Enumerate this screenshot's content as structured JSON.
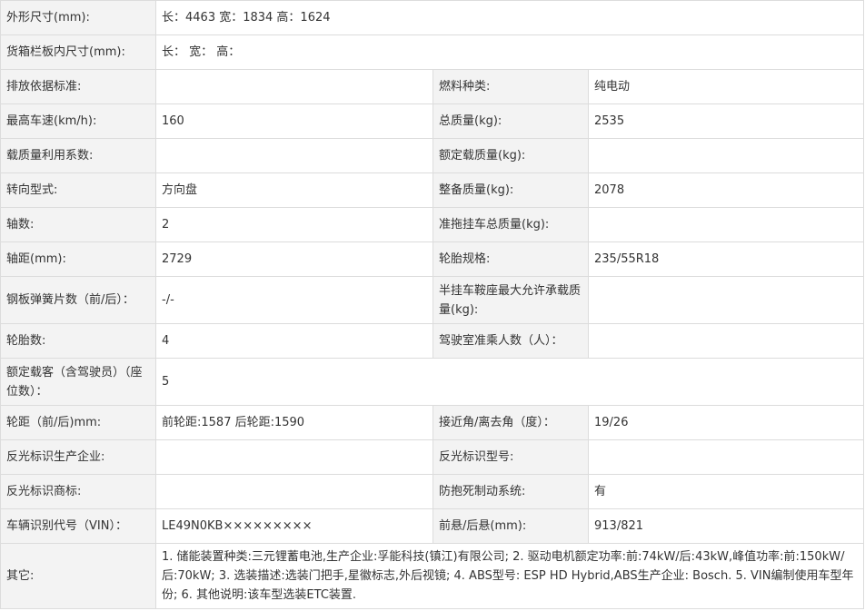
{
  "rows": [
    {
      "l1": "外形尺寸(mm):",
      "v1": "长：4463 宽：1834 高：1624"
    },
    {
      "l1": "货箱栏板内尺寸(mm):",
      "v1": "长：  宽：  高："
    },
    {
      "l1": "排放依据标准:",
      "v1": "",
      "l2": "燃料种类:",
      "v2": "纯电动"
    },
    {
      "l1": "最高车速(km/h):",
      "v1": "160",
      "l2": "总质量(kg):",
      "v2": "2535"
    },
    {
      "l1": "载质量利用系数:",
      "v1": "",
      "l2": "额定载质量(kg):",
      "v2": ""
    },
    {
      "l1": "转向型式:",
      "v1": "方向盘",
      "l2": "整备质量(kg):",
      "v2": "2078"
    },
    {
      "l1": "轴数:",
      "v1": "2",
      "l2": "准拖挂车总质量(kg):",
      "v2": ""
    },
    {
      "l1": "轴距(mm):",
      "v1": "2729",
      "l2": "轮胎规格:",
      "v2": "235/55R18"
    },
    {
      "l1": "钢板弹簧片数（前/后）：",
      "v1": "-/-",
      "l2": "半挂车鞍座最大允许承载质量(kg):",
      "v2": ""
    },
    {
      "l1": "轮胎数:",
      "v1": "4",
      "l2": "驾驶室准乘人数（人）：",
      "v2": ""
    },
    {
      "l1": "额定载客（含驾驶员）（座位数）：",
      "v1": "5"
    },
    {
      "l1": "轮距（前/后)mm:",
      "v1": "前轮距:1587 后轮距:1590",
      "l2": "接近角/离去角（度）：",
      "v2": "19/26"
    },
    {
      "l1": "反光标识生产企业:",
      "v1": "",
      "l2": "反光标识型号:",
      "v2": ""
    },
    {
      "l1": "反光标识商标:",
      "v1": "",
      "l2": "防抱死制动系统:",
      "v2": "有"
    },
    {
      "l1": "车辆识别代号（VIN）：",
      "v1": "LE49N0KB×××××××××",
      "l2": "前悬/后悬(mm):",
      "v2": "913/821"
    },
    {
      "l1": "其它:",
      "v1": "1. 储能装置种类:三元锂蓄电池,生产企业:孚能科技(镇江)有限公司; 2. 驱动电机额定功率:前:74kW/后:43kW,峰值功率:前:150kW/后:70kW; 3. 选装描述:选装门把手,星徽标志,外后视镜; 4. ABS型号: ESP HD Hybrid,ABS生产企业: Bosch. 5. VIN编制使用车型年份; 6. 其他说明:该车型选装ETC装置."
    }
  ]
}
